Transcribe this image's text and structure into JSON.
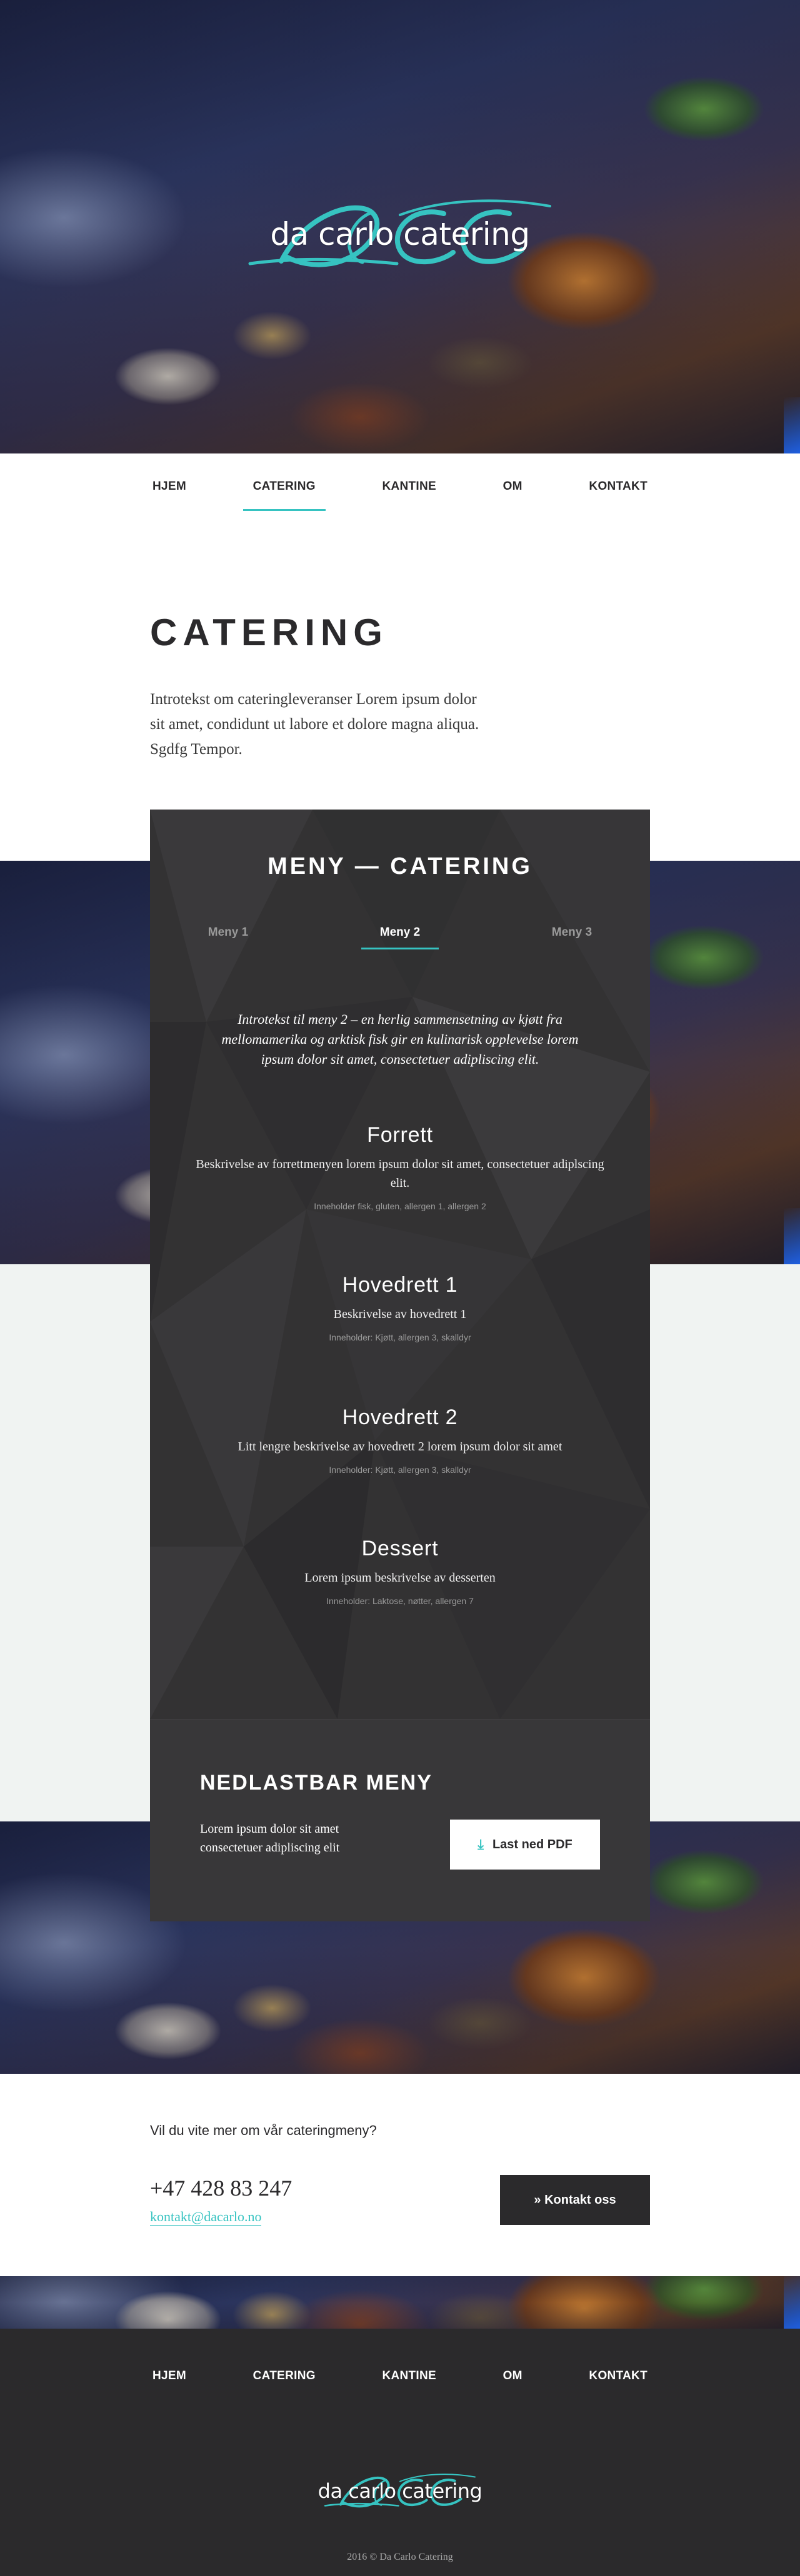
{
  "brand": {
    "logo_text": "da carlo catering",
    "monogram": "DCC"
  },
  "nav": [
    "HJEM",
    "CATERING",
    "KANTINE",
    "OM",
    "KONTAKT"
  ],
  "page": {
    "title": "CATERING",
    "intro": "Introtekst om cateringleveranser Lorem ipsum dolor sit amet, condidunt ut labore et dolore magna aliqua. Sgdfg Tempor."
  },
  "menu": {
    "title": "MENY — CATERING",
    "tabs": [
      "Meny 1",
      "Meny 2",
      "Meny 3"
    ],
    "intro": "Introtekst til meny 2 – en herlig sammensetning av kjøtt fra mellomamerika og arktisk fisk gir en kulinarisk opplevelse lorem ipsum dolor sit amet, consectetuer adipliscing elit.",
    "courses": [
      {
        "title": "Forrett",
        "description": "Beskrivelse av forrettmenyen lorem ipsum dolor sit amet, consectetuer adiplscing elit.",
        "allergens": "Inneholder fisk, gluten, allergen 1, allergen 2"
      },
      {
        "title": "Hovedrett 1",
        "description": "Beskrivelse av hovedrett 1",
        "allergens": "Inneholder: Kjøtt, allergen 3, skalldyr"
      },
      {
        "title": "Hovedrett 2",
        "description": "Litt lengre beskrivelse av hovedrett 2 lorem ipsum dolor sit amet",
        "allergens": "Inneholder: Kjøtt, allergen 3, skalldyr"
      },
      {
        "title": "Dessert",
        "description": "Lorem ipsum beskrivelse av desserten",
        "allergens": "Inneholder: Laktose, nøtter, allergen 7"
      }
    ]
  },
  "download": {
    "title": "NEDLASTBAR MENY",
    "text": "Lorem ipsum dolor sit amet consectetuer adipliscing elit",
    "button_label": "Last ned PDF",
    "icon": "download-icon"
  },
  "contact": {
    "question": "Vil du vite mer om vår cateringmeny?",
    "phone": "+47 428 83 247",
    "email": "kontakt@dacarlo.no",
    "button_label": "» Kontakt oss"
  },
  "footer": {
    "copyright": "2016 © Da Carlo Catering"
  },
  "colors": {
    "accent": "#36c3c1",
    "dark": "#2b2a2c",
    "panel": "#333233",
    "grey_band": "#f0f3f2"
  }
}
